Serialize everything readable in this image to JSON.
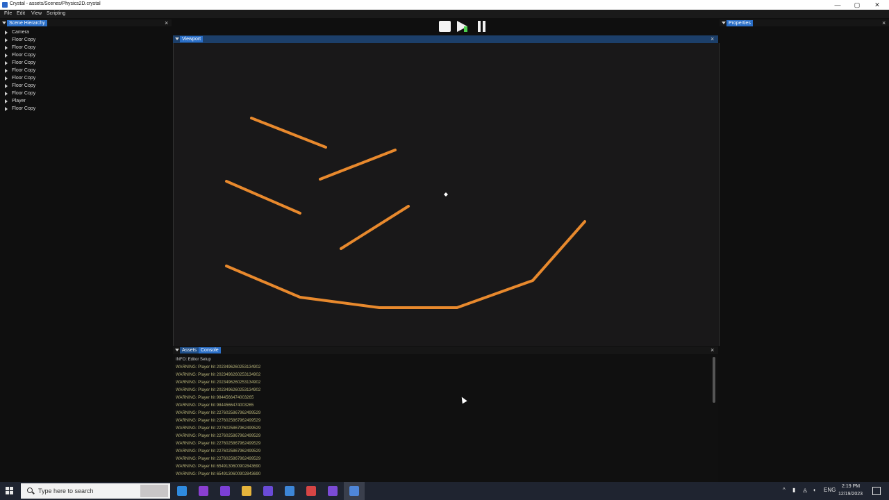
{
  "window": {
    "title": "Crystal - assets/Scenes/Physics2D.crystal",
    "controls": {
      "minimize": "—",
      "maximize": "▢",
      "close": "✕"
    }
  },
  "menu": [
    "File",
    "Edit",
    "View",
    "Scripting"
  ],
  "toolbar": {
    "stop_icon": "stop-icon",
    "play_icon": "play-icon",
    "pause_icon": "pause-icon"
  },
  "hierarchy": {
    "tab": "Scene Hierarchy",
    "items": [
      "Camera",
      "Floor Copy",
      "Floor Copy",
      "Floor Copy",
      "Floor Copy",
      "Floor Copy",
      "Floor Copy",
      "Floor Copy",
      "Floor Copy",
      "Player",
      "Floor Copy"
    ]
  },
  "viewport": {
    "tab": "Viewport",
    "floor_color": "#e8892d",
    "player_color": "#ffffff"
  },
  "properties": {
    "tab": "Properties"
  },
  "bottom": {
    "tabs": [
      "Assets",
      "Console"
    ],
    "logs": [
      {
        "level": "info",
        "text": "INFO: Editor Setup"
      },
      {
        "level": "warn",
        "text": "WARNING: Player hit 2023496260253134902"
      },
      {
        "level": "warn",
        "text": "WARNING: Player hit 2023496260253134902"
      },
      {
        "level": "warn",
        "text": "WARNING: Player hit 2023496260253134902"
      },
      {
        "level": "warn",
        "text": "WARNING: Player hit 2023496260253134902"
      },
      {
        "level": "warn",
        "text": "WARNING: Player hit 9844566474003265"
      },
      {
        "level": "warn",
        "text": "WARNING: Player hit 9844566474003265"
      },
      {
        "level": "warn",
        "text": "WARNING: Player hit 2276025867962499529"
      },
      {
        "level": "warn",
        "text": "WARNING: Player hit 2276025867962499529"
      },
      {
        "level": "warn",
        "text": "WARNING: Player hit 2276025867962499529"
      },
      {
        "level": "warn",
        "text": "WARNING: Player hit 2276025867962499529"
      },
      {
        "level": "warn",
        "text": "WARNING: Player hit 2276025867962499529"
      },
      {
        "level": "warn",
        "text": "WARNING: Player hit 2276025867962499529"
      },
      {
        "level": "warn",
        "text": "WARNING: Player hit 2276025867962499529"
      },
      {
        "level": "warn",
        "text": "WARNING: Player hit 6549130600902843690"
      },
      {
        "level": "warn",
        "text": "WARNING: Player hit 6549130600902843690"
      }
    ]
  },
  "taskbar": {
    "search_placeholder": "Type here to search",
    "time": "2:19 PM",
    "date": "12/19/2023",
    "language": "ENG",
    "apps": [
      {
        "name": "app-icon-1",
        "color": "#2f8be0"
      },
      {
        "name": "app-icon-2",
        "color": "#8a3fd1"
      },
      {
        "name": "visual-studio-icon",
        "color": "#7b3fd6"
      },
      {
        "name": "file-explorer-icon",
        "color": "#e6b43c"
      },
      {
        "name": "app-icon-5",
        "color": "#6a4bd8"
      },
      {
        "name": "app-icon-6",
        "color": "#3d86d8"
      },
      {
        "name": "chrome-icon",
        "color": "#d64545"
      },
      {
        "name": "app-icon-8",
        "color": "#7b4bd6"
      },
      {
        "name": "crystal-app-icon",
        "color": "#4f86d8"
      }
    ]
  }
}
